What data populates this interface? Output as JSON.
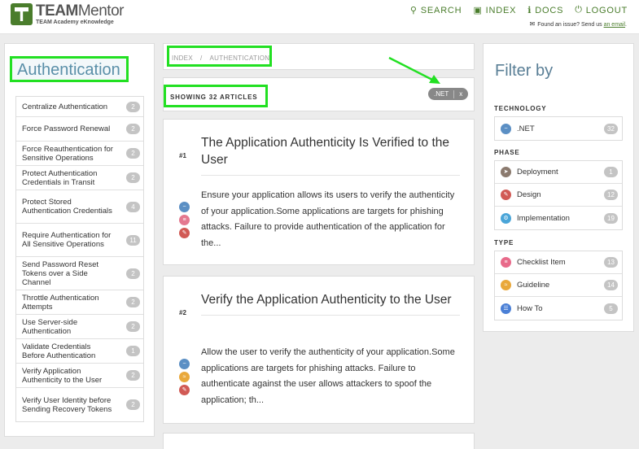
{
  "header": {
    "logo_title": "TEAM",
    "logo_title_2": "Mentor",
    "logo_subtitle": "TEAM Academy eKnowledge",
    "nav": [
      {
        "label": "SEARCH",
        "icon": "search-icon"
      },
      {
        "label": "INDEX",
        "icon": "folder-icon"
      },
      {
        "label": "DOCS",
        "icon": "info-icon"
      },
      {
        "label": "LOGOUT",
        "icon": "power-icon"
      }
    ],
    "issue_text": "Found an issue? Send us",
    "issue_link": "an email",
    "issue_end": ".",
    "accent": "#4a7d2c"
  },
  "left": {
    "title": "Authentication",
    "categories": [
      {
        "label": "Centralize Authentication",
        "count": "2"
      },
      {
        "label": "Force Password Renewal",
        "count": "2"
      },
      {
        "label": "Force Reauthentication for Sensitive Operations",
        "count": "2"
      },
      {
        "label": "Protect Authentication Credentials in Transit",
        "count": "2"
      },
      {
        "label": "Protect Stored Authentication Credentials",
        "count": "4"
      },
      {
        "label": "Require Authentication for All Sensitive Operations",
        "count": "11"
      },
      {
        "label": "Send Password Reset Tokens over a Side Channel",
        "count": "2"
      },
      {
        "label": "Throttle Authentication Attempts",
        "count": "2"
      },
      {
        "label": "Use Server-side Authentication",
        "count": "2"
      },
      {
        "label": "Validate Credentials Before Authentication",
        "count": "1"
      },
      {
        "label": "Verify Application Authenticity to the User",
        "count": "2"
      },
      {
        "label": "Verify User Identity before Sending Recovery Tokens",
        "count": "2"
      }
    ]
  },
  "breadcrumb": {
    "index": "INDEX",
    "separator": "/",
    "current": "AUTHENTICATION"
  },
  "showing": {
    "text": "SHOWING 32 ARTICLES",
    "filter_tag": ".NET",
    "remove": "x"
  },
  "articles": [
    {
      "num": "#1",
      "title": "The Application Authenticity Is Verified to the User",
      "body": "Ensure your application allows its users to verify the authenticity of your application.Some applications are targets for phishing attacks. Failure to provide authentication of the application for the..."
    },
    {
      "num": "#2",
      "title": "Verify the Application Authenticity to the User",
      "body": "Allow the user to verify the authenticity of your application.Some applications are targets for phishing attacks. Failure to authenticate against the user allows attackers to spoof the application; th..."
    }
  ],
  "filter": {
    "title": "Filter by",
    "technology": {
      "title": "TECHNOLOGY",
      "items": [
        {
          "label": ".NET",
          "count": "32"
        }
      ]
    },
    "phase": {
      "title": "PHASE",
      "items": [
        {
          "label": "Deployment",
          "count": "1"
        },
        {
          "label": "Design",
          "count": "12"
        },
        {
          "label": "Implementation",
          "count": "19"
        }
      ]
    },
    "type": {
      "title": "TYPE",
      "items": [
        {
          "label": "Checklist Item",
          "count": "13"
        },
        {
          "label": "Guideline",
          "count": "14"
        },
        {
          "label": "How To",
          "count": "5"
        }
      ]
    }
  }
}
